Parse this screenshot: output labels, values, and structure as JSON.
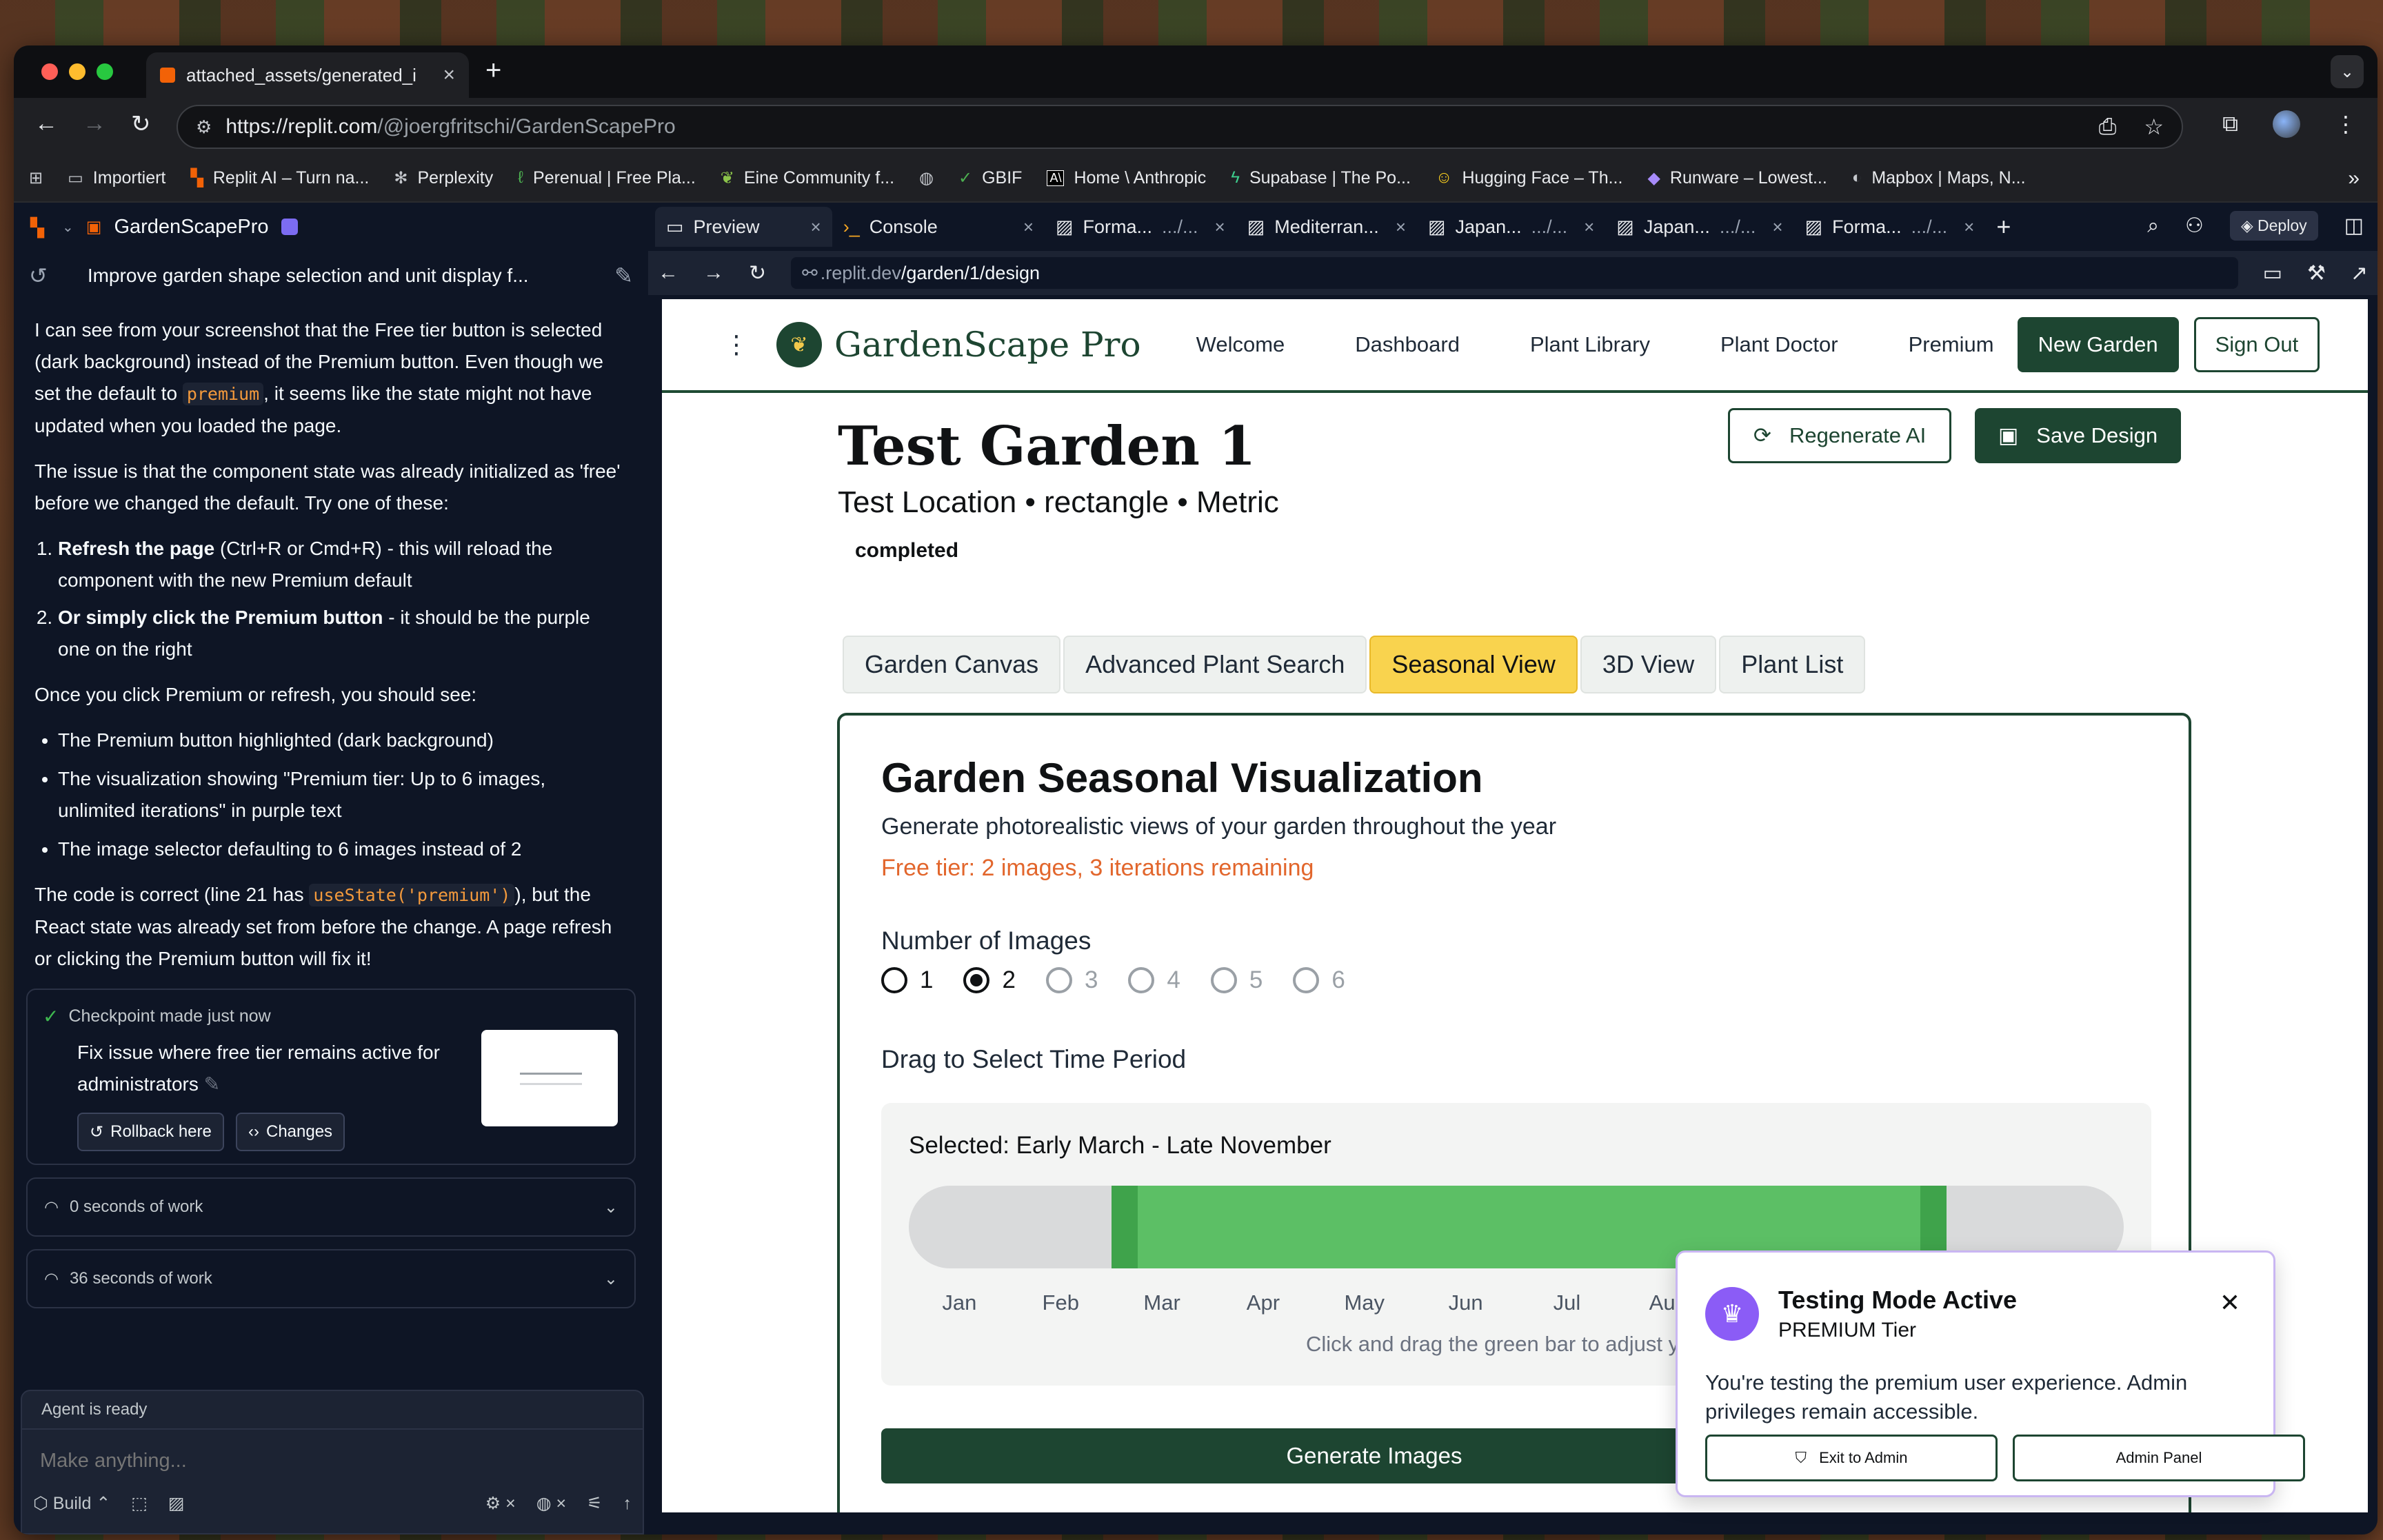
{
  "browser": {
    "tab_title": "attached_assets/generated_i",
    "url_host": "https://replit.com",
    "url_path": "/@joergfritschi/GardenScapePro",
    "bookmarks": [
      {
        "label": "Importiert",
        "icon": "folder-icon"
      },
      {
        "label": "Replit AI – Turn na...",
        "icon": "replit-icon"
      },
      {
        "label": "Perplexity",
        "icon": "perplexity-icon"
      },
      {
        "label": "Perenual | Free Pla...",
        "icon": "leaf-icon"
      },
      {
        "label": "Eine Community f...",
        "icon": "bird-icon"
      },
      {
        "label": "",
        "icon": "globe-icon"
      },
      {
        "label": "GBIF",
        "icon": "gbif-icon"
      },
      {
        "label": "Home \\ Anthropic",
        "icon": "anthropic-icon"
      },
      {
        "label": "Supabase | The Po...",
        "icon": "supabase-icon"
      },
      {
        "label": "Hugging Face – Th...",
        "icon": "huggingface-icon"
      },
      {
        "label": "Runware – Lowest...",
        "icon": "runware-icon"
      },
      {
        "label": "Mapbox | Maps, N...",
        "icon": "mapbox-icon"
      }
    ]
  },
  "agent": {
    "project_name": "GardenScapePro",
    "thread_title": "Improve garden shape selection and unit display f...",
    "p1_a": "I can see from your screenshot that the Free tier button is selected (dark background) instead of the Premium button. Even though we set the default to ",
    "p1_code": "premium",
    "p1_b": ", it seems like the state might not have updated when you loaded the page.",
    "p2": "The issue is that the component state was already initialized as 'free' before we changed the default. Try one of these:",
    "ol1_bold": "Refresh the page",
    "ol1_rest": " (Ctrl+R or Cmd+R) - this will reload the component with the new Premium default",
    "ol2_bold": "Or simply click the Premium button",
    "ol2_rest": " - it should be the purple one on the right",
    "p3": "Once you click Premium or refresh, you should see:",
    "bullets": [
      "The Premium button highlighted (dark background)",
      "The visualization showing \"Premium tier: Up to 6 images, unlimited iterations\" in purple text",
      "The image selector defaulting to 6 images instead of 2"
    ],
    "p4_a": "The code is correct (line 21 has ",
    "p4_code": "useState('premium')",
    "p4_b": "), but the React state was already set from before the change. A page refresh or clicking the Premium button will fix it!",
    "checkpoint_head": "Checkpoint made just now",
    "checkpoint_text": "Fix issue where free tier remains active for administrators",
    "rollback_label": "Rollback here",
    "changes_label": "Changes",
    "work1": "0 seconds of work",
    "work2": "36 seconds of work",
    "agent_status": "Agent is ready",
    "composer_placeholder": "Make anything...",
    "build_label": "Build"
  },
  "workspace": {
    "tabs": [
      {
        "label": "Preview",
        "suffix": "",
        "icon": "monitor-icon"
      },
      {
        "label": "Console",
        "suffix": "",
        "icon": "terminal-icon"
      },
      {
        "label": "Forma...",
        "suffix": ".../...",
        "icon": "image-icon"
      },
      {
        "label": "Mediterran...",
        "suffix": "",
        "icon": "image-icon"
      },
      {
        "label": "Japan...",
        "suffix": ".../...",
        "icon": "image-icon"
      },
      {
        "label": "Japan...",
        "suffix": ".../...",
        "icon": "image-icon"
      },
      {
        "label": "Forma...",
        "suffix": ".../...",
        "icon": "image-icon"
      }
    ],
    "deploy_label": "Deploy",
    "preview_url_host": ".replit.dev",
    "preview_url_path": "/garden/1/design"
  },
  "app": {
    "brand": "GardenScape Pro",
    "nav": [
      "Welcome",
      "Dashboard",
      "Plant Library",
      "Plant Doctor",
      "Premium"
    ],
    "new_garden": "New Garden",
    "sign_out": "Sign Out",
    "garden_title": "Test Garden 1",
    "garden_sub": "Test Location • rectangle • Metric",
    "status": "completed",
    "regenerate": "Regenerate AI",
    "save": "Save Design",
    "tabs": [
      "Garden Canvas",
      "Advanced Plant Search",
      "Seasonal View",
      "3D View",
      "Plant List"
    ],
    "active_tab": "Seasonal View",
    "card_title": "Garden Seasonal Visualization",
    "card_desc": "Generate photorealistic views of your garden throughout the year",
    "card_tier": "Free tier: 2 images, 3 iterations remaining",
    "num_images_label": "Number of Images",
    "image_options": [
      "1",
      "2",
      "3",
      "4",
      "5",
      "6"
    ],
    "selected_images": "2",
    "time_label": "Drag to Select Time Period",
    "selected_period": "Selected: Early March - Late November",
    "months": [
      "Jan",
      "Feb",
      "Mar",
      "Apr",
      "May",
      "Jun",
      "Jul",
      "Aug"
    ],
    "range_start_month": 3,
    "range_end_month": 11,
    "hint": "Click and drag the green bar to adjust your ti",
    "generate": "Generate Images",
    "colors": {
      "primary": "#1d4531",
      "accent": "#f9d34e",
      "range": "#5cbf65",
      "tier": "#e2662c",
      "toast_accent": "#8b5cf6"
    }
  },
  "toast": {
    "title": "Testing Mode Active",
    "tier": "PREMIUM Tier",
    "body": "You're testing the premium user experience. Admin privileges remain accessible.",
    "exit": "Exit to Admin",
    "panel": "Admin Panel"
  }
}
